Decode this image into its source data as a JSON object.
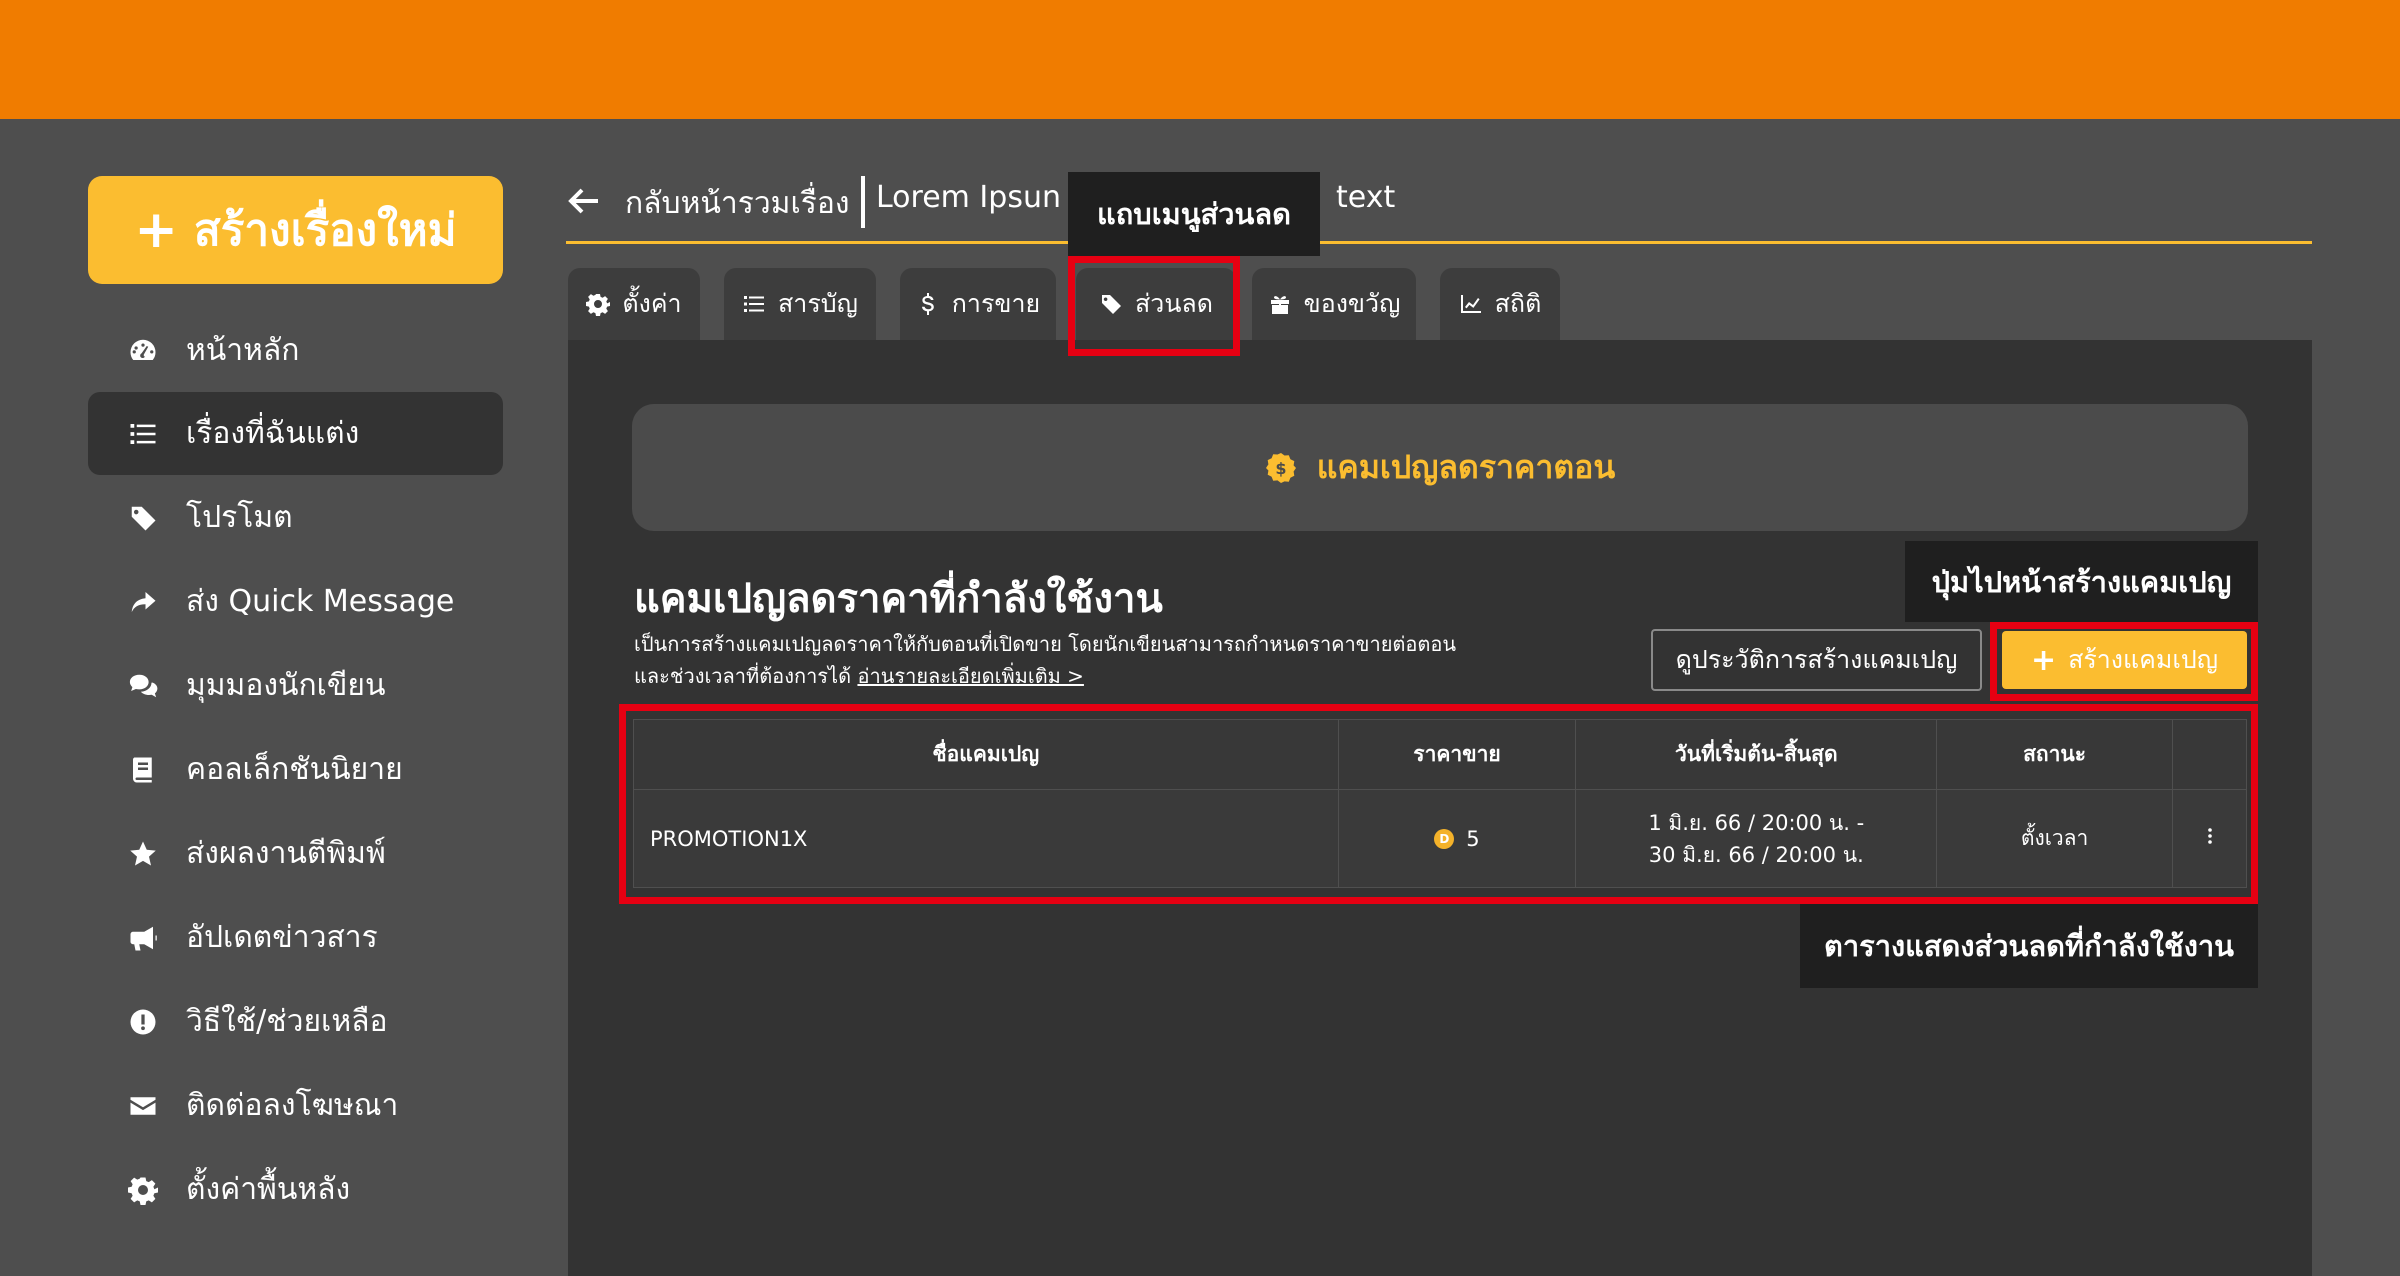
{
  "sidebar": {
    "create_label": "สร้างเรื่องใหม่",
    "items": [
      {
        "label": "หน้าหลัก",
        "icon": "dashboard-icon"
      },
      {
        "label": "เรื่องที่ฉันแต่ง",
        "icon": "list-icon",
        "active": true
      },
      {
        "label": "โปรโมต",
        "icon": "tag-icon"
      },
      {
        "label": "ส่ง Quick Message",
        "icon": "share-icon"
      },
      {
        "label": "มุมมองนักเขียน",
        "icon": "comments-icon"
      },
      {
        "label": "คอลเล็กชันนิยาย",
        "icon": "book-icon"
      },
      {
        "label": "ส่งผลงานตีพิมพ์",
        "icon": "star-icon"
      },
      {
        "label": "อัปเดตข่าวสาร",
        "icon": "megaphone-icon"
      },
      {
        "label": "วิธีใช้/ช่วยเหลือ",
        "icon": "exclamation-icon"
      },
      {
        "label": "ติดต่อลงโฆษณา",
        "icon": "envelope-icon"
      },
      {
        "label": "ตั้งค่าพื้นหลัง",
        "icon": "gear-icon"
      }
    ]
  },
  "header": {
    "back_label": "กลับหน้ารวมเรื่อง",
    "story_title": "Lorem Ipsun i",
    "story_title_tail": "text"
  },
  "tabs": [
    {
      "label": "ตั้งค่า",
      "icon": "gear-icon"
    },
    {
      "label": "สารบัญ",
      "icon": "list-icon"
    },
    {
      "label": "การขาย",
      "icon": "dollar-icon"
    },
    {
      "label": "ส่วนลด",
      "icon": "tag-icon",
      "active": true
    },
    {
      "label": "ของขวัญ",
      "icon": "gift-icon"
    },
    {
      "label": "สถิติ",
      "icon": "chart-icon"
    }
  ],
  "main": {
    "campaign_card_label": "แคมเปญลดราคาตอน",
    "section_title": "แคมเปญลดราคาที่กำลังใช้งาน",
    "description_line1": "เป็นการสร้างแคมเปญลดราคาให้กับตอนที่เปิดขาย โดยนักเขียนสามารถกำหนดราคาขายต่อตอน",
    "description_line2": "และช่วงเวลาที่ต้องการได้",
    "read_more": "อ่านรายละเอียดเพิ่มเติม >",
    "history_button": "ดูประวัติการสร้างแคมเปญ",
    "new_campaign_button": "สร้างแคมเปญ",
    "table": {
      "headers": [
        "ชื่อแคมเปญ",
        "ราคาขาย",
        "วันที่เริ่มต้น-สิ้นสุด",
        "สถานะ",
        ""
      ],
      "rows": [
        {
          "name": "PROMOTION1X",
          "price": "5",
          "coin_symbol": "D",
          "date_start": "1 มิ.ย. 66 / 20:00 น. -",
          "date_end": "30 มิ.ย. 66 / 20:00 น.",
          "status": "ตั้งเวลา"
        }
      ]
    }
  },
  "annotations": {
    "tab_note": "แถบเมนูส่วนลด",
    "button_note": "ปุ่มไปหน้าสร้างแคมเปญ",
    "table_note": "ตารางแสดงส่วนลดที่กำลังใช้งาน",
    "highlight_color": "#e60012"
  },
  "colors": {
    "brand_orange": "#f07c00",
    "accent_yellow": "#fbbd30"
  }
}
